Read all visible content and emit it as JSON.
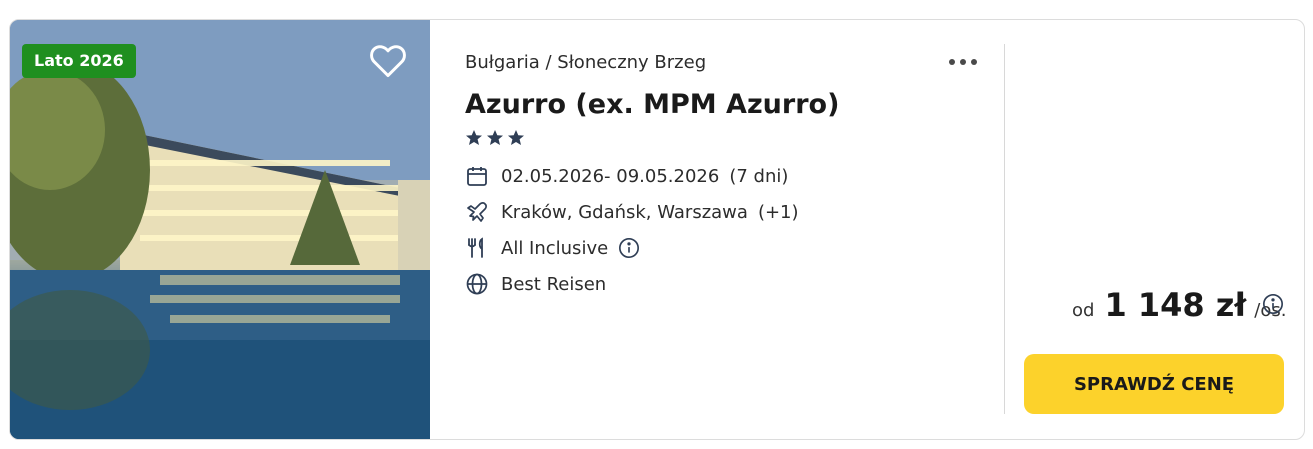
{
  "badge": {
    "label": "Lato 2026",
    "color": "#1f8f1f"
  },
  "hotel": {
    "location": "Bułgaria / Słoneczny Brzeg",
    "name": "Azurro (ex. MPM Azurro)",
    "stars": 3
  },
  "details": {
    "dates": "02.05.2026- 09.05.2026",
    "duration": "(7 dni)",
    "departure": "Kraków, Gdańsk, Warszawa",
    "departure_more": "(+1)",
    "board": "All Inclusive",
    "operator": "Best Reisen"
  },
  "icons": {
    "favorite": "heart-icon",
    "more": "more-dots-icon",
    "star": "star-icon",
    "calendar": "calendar-icon",
    "plane": "plane-icon",
    "board": "cutlery-icon",
    "info": "info-icon",
    "operator": "globe-icon"
  },
  "price": {
    "prefix": "od",
    "amount": "1 148 zł",
    "suffix": "/os."
  },
  "cta": {
    "label": "SPRAWDŹ CENĘ",
    "color": "#fcd22b"
  }
}
